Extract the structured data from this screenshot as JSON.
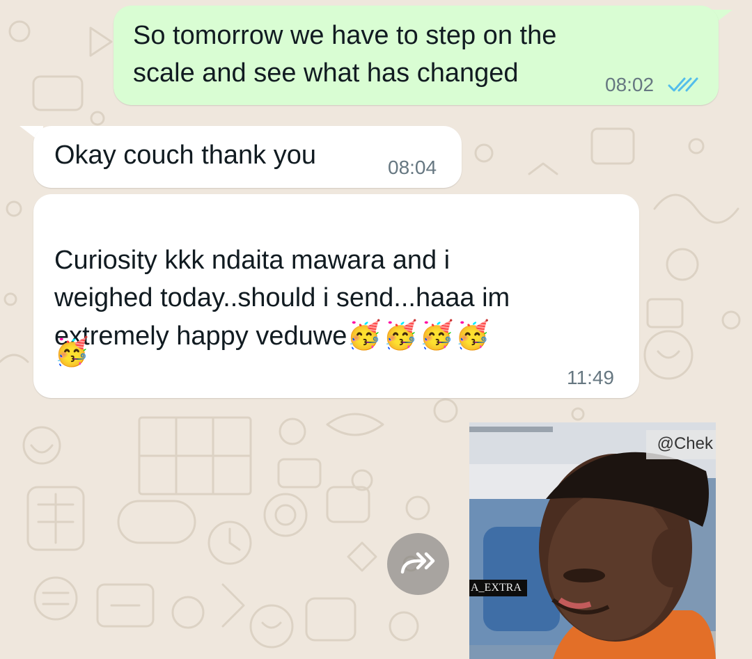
{
  "messages": [
    {
      "id": "m1",
      "direction": "outgoing",
      "text": "So tomorrow we have to step on the\nscale and see what has changed",
      "time": "08:02",
      "status": "read"
    },
    {
      "id": "m2",
      "direction": "incoming",
      "text": "Okay couch thank you",
      "time": "08:04"
    },
    {
      "id": "m3",
      "direction": "incoming",
      "text": "Curiosity kkk ndaita mawara and i\nweighed today..should i send...haaa im\nextremely happy veduwe",
      "emoji_line1": "🥳🥳🥳🥳",
      "emoji_line2": "🥳",
      "time": "11:49"
    }
  ],
  "media_message": {
    "watermark": "@Chek",
    "caption_tag": "A_EXTRA"
  },
  "icons": {
    "read_ticks": "double-check-icon",
    "forward": "forward-icon"
  },
  "colors": {
    "outgoing_bubble": "#d9fdd3",
    "incoming_bubble": "#ffffff",
    "wallpaper": "#efe7dd",
    "read_tick": "#53bdeb",
    "timestamp": "#667781"
  }
}
